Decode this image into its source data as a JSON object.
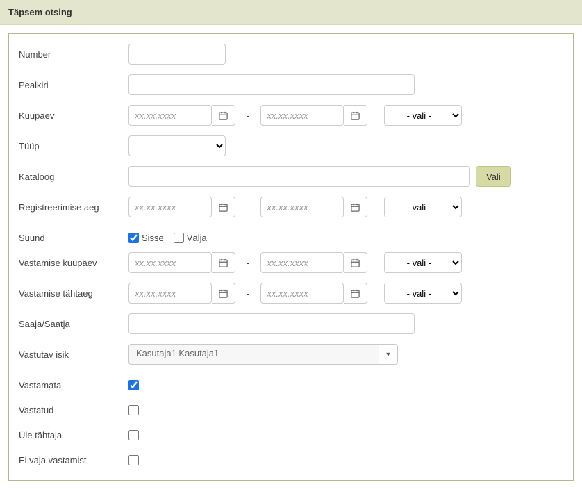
{
  "header": {
    "title": "Täpsem otsing"
  },
  "labels": {
    "number": "Number",
    "title": "Pealkiri",
    "date": "Kuupäev",
    "type": "Tüüp",
    "catalog": "Kataloog",
    "regtime": "Registreerimise aeg",
    "direction": "Suund",
    "responseDate": "Vastamise kuupäev",
    "responseDeadline": "Vastamise tähtaeg",
    "recipient": "Saaja/Saatja",
    "responsible": "Vastutav isik",
    "unanswered": "Vastamata",
    "answered": "Vastatud",
    "overdue": "Üle tähtaja",
    "noneed": "Ei vaja vastamist"
  },
  "placeholders": {
    "date": "xx.xx.xxxx"
  },
  "options": {
    "vali": "- vali -"
  },
  "buttons": {
    "vali": "Vali"
  },
  "direction": {
    "in": "Sisse",
    "out": "Välja",
    "inChecked": true,
    "outChecked": false
  },
  "responsible": {
    "value": "Kasutaja1 Kasutaja1"
  },
  "status": {
    "unanswered": true,
    "answered": false,
    "overdue": false,
    "noneed": false
  },
  "dashes": {
    "d": "-"
  }
}
